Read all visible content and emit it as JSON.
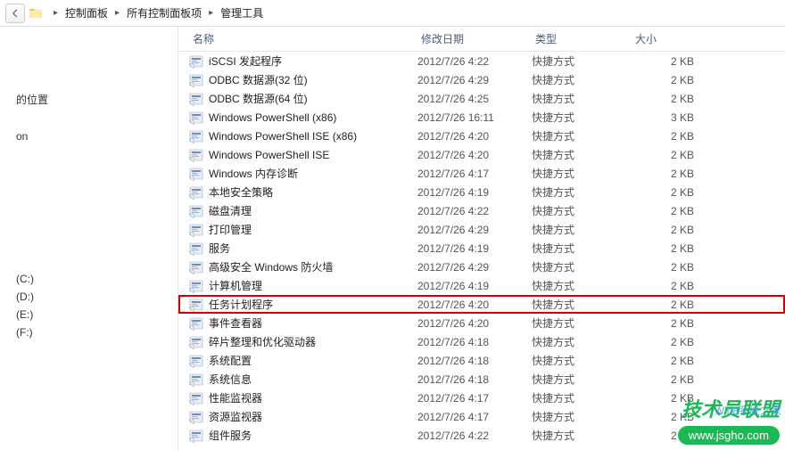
{
  "breadcrumb": {
    "items": [
      "控制面板",
      "所有控制面板项",
      "管理工具"
    ]
  },
  "columns": {
    "name": "名称",
    "date": "修改日期",
    "type": "类型",
    "size": "大小"
  },
  "sidebar": {
    "items": [
      "的位置",
      "",
      "on",
      "",
      "",
      "",
      "(C:)",
      "(D:)",
      "(E:)",
      "(F:)"
    ]
  },
  "shared": {
    "type_shortcut": "快捷方式",
    "size_2kb": "2 KB",
    "size_3kb": "3 KB"
  },
  "files": [
    {
      "name": "iSCSI 发起程序",
      "date": "2012/7/26 4:22",
      "size": "2 KB"
    },
    {
      "name": "ODBC 数据源(32 位)",
      "date": "2012/7/26 4:29",
      "size": "2 KB"
    },
    {
      "name": "ODBC 数据源(64 位)",
      "date": "2012/7/26 4:25",
      "size": "2 KB"
    },
    {
      "name": "Windows PowerShell (x86)",
      "date": "2012/7/26 16:11",
      "size": "3 KB"
    },
    {
      "name": "Windows PowerShell ISE (x86)",
      "date": "2012/7/26 4:20",
      "size": "2 KB"
    },
    {
      "name": "Windows PowerShell ISE",
      "date": "2012/7/26 4:20",
      "size": "2 KB"
    },
    {
      "name": "Windows 内存诊断",
      "date": "2012/7/26 4:17",
      "size": "2 KB"
    },
    {
      "name": "本地安全策略",
      "date": "2012/7/26 4:19",
      "size": "2 KB"
    },
    {
      "name": "磁盘清理",
      "date": "2012/7/26 4:22",
      "size": "2 KB"
    },
    {
      "name": "打印管理",
      "date": "2012/7/26 4:29",
      "size": "2 KB"
    },
    {
      "name": "服务",
      "date": "2012/7/26 4:19",
      "size": "2 KB"
    },
    {
      "name": "高级安全 Windows 防火墙",
      "date": "2012/7/26 4:29",
      "size": "2 KB"
    },
    {
      "name": "计算机管理",
      "date": "2012/7/26 4:19",
      "size": "2 KB"
    },
    {
      "name": "任务计划程序",
      "date": "2012/7/26 4:20",
      "size": "2 KB",
      "highlight": true
    },
    {
      "name": "事件查看器",
      "date": "2012/7/26 4:20",
      "size": "2 KB"
    },
    {
      "name": "碎片整理和优化驱动器",
      "date": "2012/7/26 4:18",
      "size": "2 KB"
    },
    {
      "name": "系统配置",
      "date": "2012/7/26 4:18",
      "size": "2 KB"
    },
    {
      "name": "系统信息",
      "date": "2012/7/26 4:18",
      "size": "2 KB"
    },
    {
      "name": "性能监视器",
      "date": "2012/7/26 4:17",
      "size": "2 KB"
    },
    {
      "name": "资源监视器",
      "date": "2012/7/26 4:17",
      "size": "2 KB"
    },
    {
      "name": "组件服务",
      "date": "2012/7/26 4:22",
      "size": "2 KB"
    }
  ],
  "watermark": {
    "brand": "技术员联盟",
    "url": "www.jsgho.com",
    "small": "Win8系统之家"
  }
}
